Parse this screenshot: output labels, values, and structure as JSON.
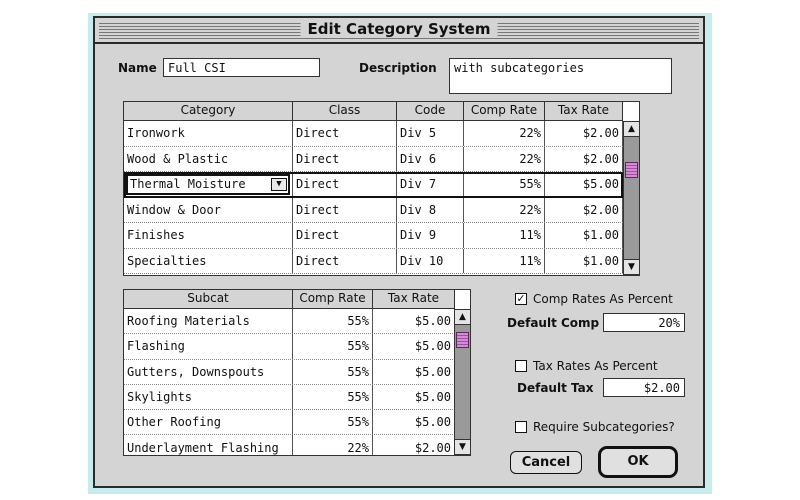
{
  "dialog": {
    "title": "Edit Category System"
  },
  "name": {
    "label": "Name",
    "value": "Full CSI"
  },
  "description": {
    "label": "Description",
    "value": "with subcategories"
  },
  "category_table": {
    "columns": [
      "Category",
      "Class",
      "Code",
      "Comp Rate",
      "Tax Rate"
    ],
    "rows": [
      [
        "Ironwork",
        "Direct",
        "Div 5",
        "22%",
        "$2.00"
      ],
      [
        "Wood & Plastic",
        "Direct",
        "Div 6",
        "22%",
        "$2.00"
      ],
      [
        "Thermal Moisture",
        "Direct",
        "Div 7",
        "55%",
        "$5.00"
      ],
      [
        "Window & Door",
        "Direct",
        "Div 8",
        "22%",
        "$2.00"
      ],
      [
        "Finishes",
        "Direct",
        "Div 9",
        "11%",
        "$1.00"
      ],
      [
        "Specialties",
        "Direct",
        "Div 10",
        "11%",
        "$1.00"
      ]
    ],
    "selected_row": 2
  },
  "subcat_table": {
    "columns": [
      "Subcat",
      "Comp Rate",
      "Tax Rate"
    ],
    "rows": [
      [
        "Roofing Materials",
        "55%",
        "$5.00"
      ],
      [
        "Flashing",
        "55%",
        "$5.00"
      ],
      [
        "Gutters, Downspouts",
        "55%",
        "$5.00"
      ],
      [
        "Skylights",
        "55%",
        "$5.00"
      ],
      [
        "Other Roofing",
        "55%",
        "$5.00"
      ],
      [
        "Underlayment Flashing",
        "22%",
        "$2.00"
      ]
    ]
  },
  "options": {
    "comp_percent": {
      "label": "Comp Rates As Percent",
      "checked": true
    },
    "default_comp": {
      "label": "Default Comp",
      "value": "20%"
    },
    "tax_percent": {
      "label": "Tax Rates As Percent",
      "checked": false
    },
    "default_tax": {
      "label": "Default Tax",
      "value": "$2.00"
    },
    "require_subcat": {
      "label": "Require Subcategories?",
      "checked": false
    }
  },
  "buttons": {
    "cancel": "Cancel",
    "ok": "OK"
  },
  "colors": {
    "window_bg": "#d4d4d4",
    "scroll_thumb": "#d48ad4",
    "shadow": "#c8ecec"
  },
  "icons": {
    "dropdown": "triangle-down-icon",
    "scroll_up": "up-arrow-icon",
    "scroll_down": "down-arrow-icon"
  }
}
